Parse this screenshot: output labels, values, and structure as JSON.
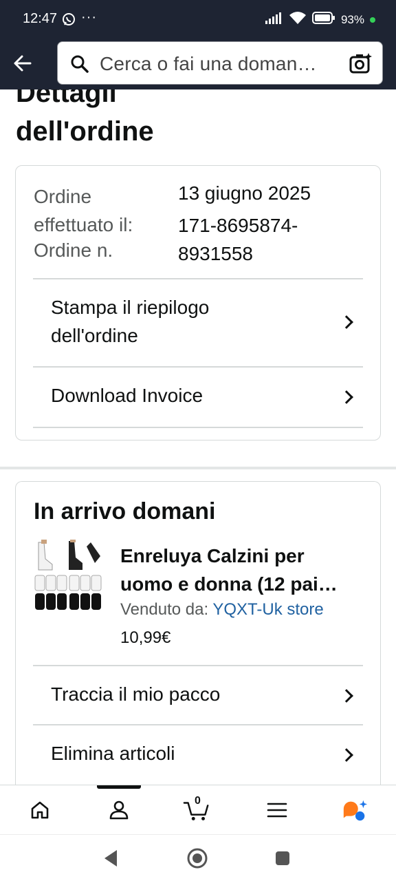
{
  "status_bar": {
    "time": "12:47",
    "dots": "···",
    "battery": "93%"
  },
  "search": {
    "placeholder": "Cerca o fai una doman…"
  },
  "page_title_line1": "Dettagli",
  "page_title_line2": "dell'ordine",
  "order": {
    "placed_label": "Ordine effettuato il:",
    "placed_label_line1": "Ordine",
    "placed_label_line2": "effettuato il:",
    "placed_value": "13 giugno 2025",
    "number_label": "Ordine n.",
    "number_value_line1": "171-8695874-",
    "number_value_line2": "8931558"
  },
  "actions": {
    "print_summary_line1": "Stampa il riepilogo",
    "print_summary_line2": "dell'ordine",
    "download_invoice": "Download Invoice"
  },
  "shipment": {
    "title": "In arrivo domani",
    "product_name_line1": "Enreluya Calzini per",
    "product_name_line2": "uomo e donna (12 pai…",
    "sold_by_label": "Venduto da:",
    "seller": "YQXT-Uk store",
    "price": "10,99€",
    "track_label": "Traccia il mio pacco",
    "delete_label": "Elimina articoli"
  },
  "bottom_nav": {
    "cart_count": "0"
  },
  "colors": {
    "header_bg": "#1e2433",
    "link": "#2162a1",
    "accent_orange": "#ff7a1a",
    "accent_blue": "#1a73e8"
  }
}
